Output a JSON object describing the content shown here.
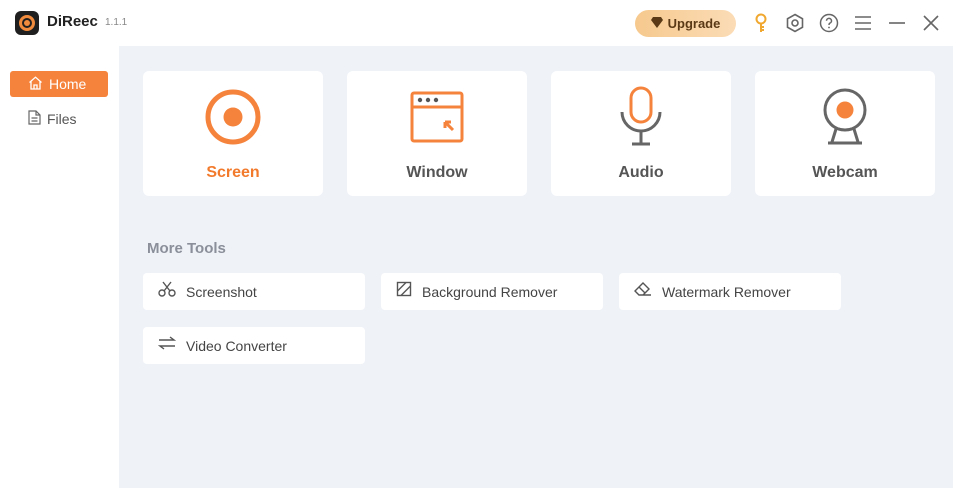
{
  "app": {
    "name": "DiReec",
    "version": "1.1.1"
  },
  "titlebar": {
    "upgrade_label": "Upgrade",
    "icons": [
      "key-icon",
      "settings-icon",
      "help-icon",
      "menu-icon",
      "minimize-icon",
      "close-icon"
    ]
  },
  "sidebar": {
    "items": [
      {
        "label": "Home",
        "icon": "home-icon",
        "active": true
      },
      {
        "label": "Files",
        "icon": "file-icon",
        "active": false
      }
    ]
  },
  "main": {
    "cards": [
      {
        "label": "Screen",
        "icon": "screen-record-icon",
        "selected": true
      },
      {
        "label": "Window",
        "icon": "window-icon",
        "selected": false
      },
      {
        "label": "Audio",
        "icon": "microphone-icon",
        "selected": false
      },
      {
        "label": "Webcam",
        "icon": "webcam-icon",
        "selected": false
      }
    ],
    "more_tools_title": "More Tools",
    "tools": [
      {
        "label": "Screenshot",
        "icon": "scissors-icon"
      },
      {
        "label": "Background Remover",
        "icon": "background-remove-icon"
      },
      {
        "label": "Watermark Remover",
        "icon": "eraser-icon"
      },
      {
        "label": "Video Converter",
        "icon": "convert-arrows-icon"
      }
    ]
  },
  "colors": {
    "accent": "#f5833c",
    "main_bg": "#eff2f7",
    "upgrade_gold": "#f6c98e",
    "text_gray": "#555555"
  }
}
